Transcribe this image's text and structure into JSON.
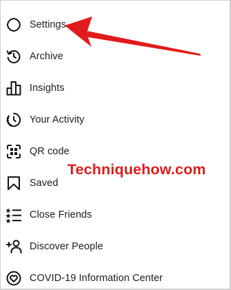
{
  "menu": {
    "items": [
      {
        "label": "Settings",
        "icon": "settings-gear-icon"
      },
      {
        "label": "Archive",
        "icon": "archive-history-icon"
      },
      {
        "label": "Insights",
        "icon": "insights-bar-chart-icon"
      },
      {
        "label": "Your Activity",
        "icon": "activity-clock-icon"
      },
      {
        "label": "QR code",
        "icon": "qr-code-icon"
      },
      {
        "label": "Saved",
        "icon": "bookmark-icon"
      },
      {
        "label": "Close Friends",
        "icon": "close-friends-list-icon"
      },
      {
        "label": "Discover People",
        "icon": "add-person-icon"
      },
      {
        "label": "COVID-19 Information Center",
        "icon": "covid-heart-icon"
      }
    ]
  },
  "watermark": {
    "text": "Techniquehow.com"
  },
  "colors": {
    "annotation_red": "#e11b1b",
    "text": "#1c1c1c"
  }
}
